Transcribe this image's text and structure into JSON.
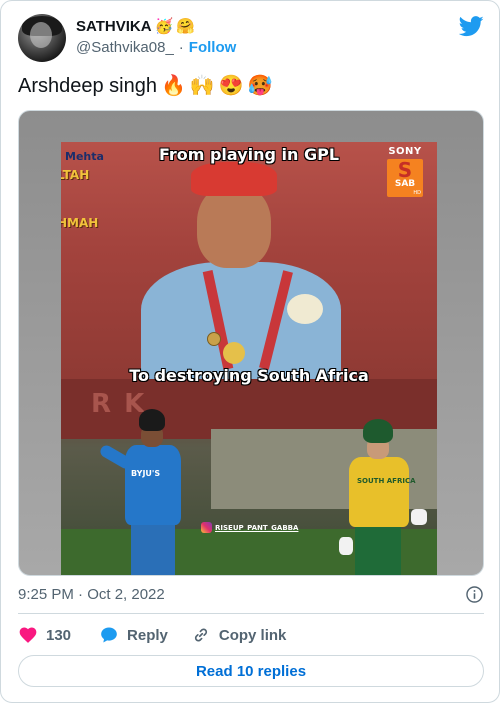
{
  "author": {
    "display_name": "SATHVIKA",
    "name_emojis": [
      "🥳",
      "🤗"
    ],
    "handle": "@Sathvika08_",
    "separator": "·",
    "follow_label": "Follow"
  },
  "tweet": {
    "text": "Arshdeep singh",
    "emojis": [
      "🔥",
      "🙌",
      "😍",
      "🥵"
    ]
  },
  "media": {
    "top_caption": "From playing in GPL",
    "bottom_caption": "To destroying South Africa",
    "sign_text_1": "Mehta",
    "sign_text_2": "LTAH",
    "sign_text_3": "HMAH",
    "channel_name": "SONY",
    "channel_logo_letter": "S",
    "channel_logo_text": "SAB",
    "channel_logo_hd": "HD",
    "backdrop_text": "R K",
    "jersey_text": "BYJU'S",
    "jersey_text_2": "SOUTH AFRICA",
    "watermark": "RISEUP_PANT_GABBA"
  },
  "meta": {
    "timestamp": "9:25 PM · Oct 2, 2022"
  },
  "actions": {
    "like_count": "130",
    "reply_label": "Reply",
    "copy_link_label": "Copy link"
  },
  "read_replies_label": "Read 10 replies",
  "colors": {
    "twitter_blue": "#1d9bf0",
    "like_pink": "#f91880",
    "link_blue": "#006fd6",
    "muted_gray": "#536471",
    "border": "#cfd9de"
  }
}
